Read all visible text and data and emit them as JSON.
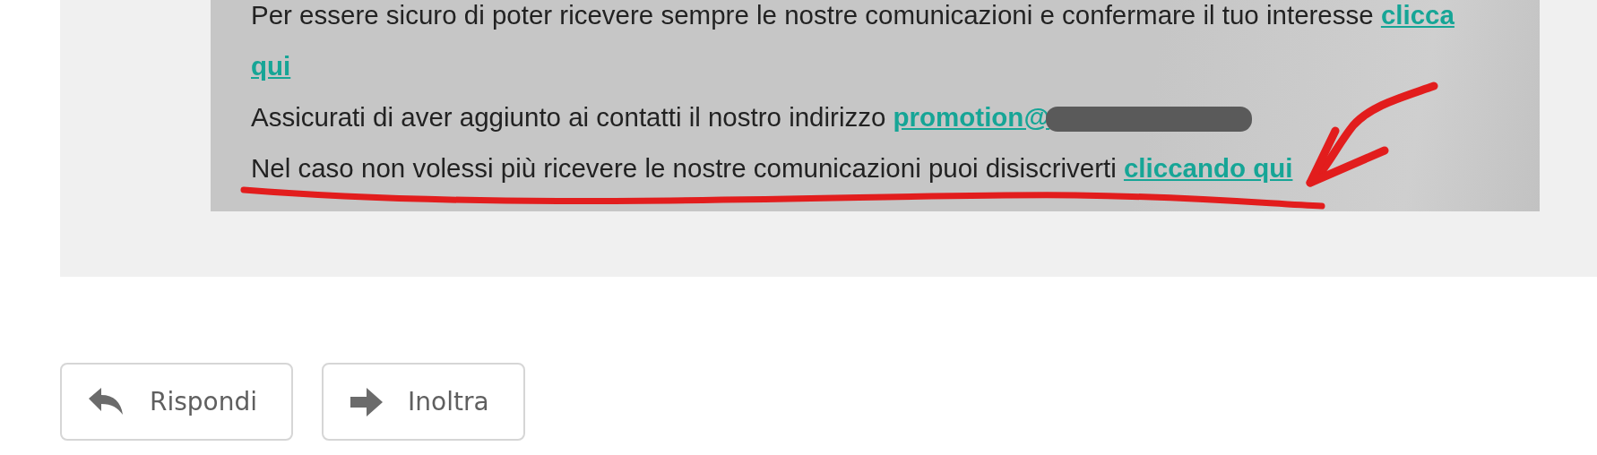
{
  "message": {
    "paragraphs": [
      {
        "text": "Per essere sicuro di poter ricevere sempre le nostre comunicazioni e confermare il tuo interesse ",
        "link": "clicca",
        "redacted": false
      },
      {
        "link": "qui",
        "redacted": false
      },
      {
        "text": "Assicurati di aver aggiunto ai contatti il nostro indirizzo ",
        "link": "promotion@",
        "redacted": true
      },
      {
        "text": "Nel caso non volessi più ricevere le nostre comunicazioni puoi disiscriverti ",
        "link": "cliccando qui",
        "redacted": false
      }
    ]
  },
  "actions": [
    {
      "label": "Rispondi",
      "kind": "reply"
    },
    {
      "label": "Inoltra",
      "kind": "forward"
    }
  ]
}
